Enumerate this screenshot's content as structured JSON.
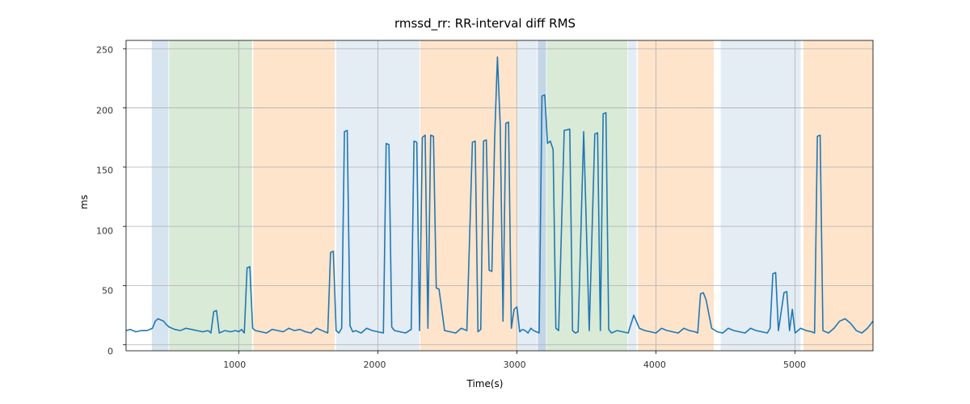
{
  "chart_data": {
    "type": "line",
    "title": "rmssd_rr: RR-interval diff RMS",
    "xlabel": "Time(s)",
    "ylabel": "ms",
    "xlim": [
      190,
      5560
    ],
    "ylim": [
      -5,
      257
    ],
    "x_ticks": [
      1000,
      2000,
      3000,
      4000,
      5000
    ],
    "y_ticks": [
      0,
      50,
      100,
      150,
      200,
      250
    ],
    "background_bands": [
      {
        "start": 375,
        "end": 495,
        "color": "#d6e4ef"
      },
      {
        "start": 500,
        "end": 1095,
        "color": "#d9ead7"
      },
      {
        "start": 1105,
        "end": 1690,
        "color": "#fde4cb"
      },
      {
        "start": 1700,
        "end": 2300,
        "color": "#e4ecf4"
      },
      {
        "start": 2305,
        "end": 3000,
        "color": "#fde4cb"
      },
      {
        "start": 3005,
        "end": 3145,
        "color": "#e4ecf4"
      },
      {
        "start": 3150,
        "end": 3210,
        "color": "#c3d6e6"
      },
      {
        "start": 3215,
        "end": 3795,
        "color": "#d9ead7"
      },
      {
        "start": 3800,
        "end": 3860,
        "color": "#e4ecf4"
      },
      {
        "start": 3870,
        "end": 4415,
        "color": "#fde4cb"
      },
      {
        "start": 4465,
        "end": 5040,
        "color": "#e4ecf4"
      },
      {
        "start": 5060,
        "end": 5560,
        "color": "#fde4cb"
      }
    ],
    "series": [
      {
        "name": "rmssd_rr",
        "color": "#1f77b4",
        "x": [
          190,
          220,
          260,
          300,
          340,
          380,
          400,
          420,
          440,
          460,
          480,
          500,
          540,
          580,
          620,
          660,
          700,
          740,
          780,
          800,
          820,
          840,
          860,
          900,
          940,
          980,
          1000,
          1020,
          1040,
          1060,
          1080,
          1100,
          1120,
          1160,
          1200,
          1240,
          1280,
          1320,
          1360,
          1400,
          1440,
          1480,
          1520,
          1560,
          1600,
          1640,
          1660,
          1680,
          1700,
          1720,
          1740,
          1760,
          1780,
          1800,
          1820,
          1840,
          1880,
          1920,
          1960,
          2000,
          2040,
          2060,
          2080,
          2100,
          2120,
          2160,
          2200,
          2240,
          2260,
          2280,
          2300,
          2320,
          2340,
          2360,
          2380,
          2400,
          2420,
          2440,
          2480,
          2520,
          2560,
          2600,
          2640,
          2680,
          2700,
          2720,
          2740,
          2760,
          2780,
          2800,
          2820,
          2840,
          2860,
          2880,
          2900,
          2920,
          2940,
          2960,
          2980,
          3000,
          3020,
          3040,
          3060,
          3080,
          3100,
          3120,
          3140,
          3160,
          3180,
          3200,
          3220,
          3240,
          3260,
          3280,
          3300,
          3340,
          3380,
          3400,
          3420,
          3440,
          3480,
          3520,
          3560,
          3580,
          3600,
          3620,
          3640,
          3660,
          3680,
          3720,
          3760,
          3800,
          3840,
          3880,
          3920,
          3960,
          4000,
          4040,
          4080,
          4120,
          4160,
          4200,
          4240,
          4280,
          4300,
          4320,
          4340,
          4360,
          4400,
          4440,
          4480,
          4520,
          4560,
          4600,
          4640,
          4680,
          4720,
          4760,
          4800,
          4820,
          4840,
          4860,
          4880,
          4920,
          4940,
          4960,
          4980,
          5000,
          5040,
          5080,
          5120,
          5140,
          5160,
          5180,
          5200,
          5240,
          5280,
          5320,
          5360,
          5400,
          5440,
          5480,
          5520,
          5560
        ],
        "y": [
          12,
          13,
          11,
          12,
          12,
          14,
          20,
          22,
          21,
          20,
          17,
          15,
          13,
          12,
          14,
          13,
          12,
          11,
          12,
          10,
          28,
          29,
          10,
          12,
          11,
          12,
          11,
          13,
          10,
          65,
          66,
          14,
          12,
          11,
          10,
          13,
          12,
          11,
          14,
          12,
          13,
          11,
          10,
          14,
          12,
          10,
          78,
          79,
          12,
          10,
          14,
          180,
          181,
          16,
          11,
          12,
          10,
          14,
          12,
          11,
          10,
          170,
          169,
          15,
          12,
          11,
          10,
          13,
          172,
          171,
          12,
          175,
          177,
          14,
          177,
          176,
          48,
          47,
          12,
          11,
          10,
          14,
          12,
          171,
          172,
          11,
          13,
          172,
          173,
          63,
          62,
          175,
          243,
          185,
          20,
          187,
          188,
          14,
          30,
          32,
          11,
          13,
          12,
          10,
          14,
          12,
          11,
          10,
          210,
          211,
          170,
          172,
          165,
          14,
          12,
          181,
          182,
          12,
          10,
          11,
          180,
          12,
          178,
          179,
          12,
          195,
          196,
          13,
          10,
          12,
          11,
          10,
          25,
          14,
          12,
          11,
          10,
          14,
          12,
          11,
          10,
          14,
          12,
          11,
          10,
          43,
          44,
          38,
          14,
          11,
          10,
          14,
          12,
          11,
          10,
          14,
          12,
          11,
          10,
          14,
          60,
          61,
          12,
          44,
          45,
          12,
          30,
          10,
          14,
          12,
          11,
          10,
          176,
          177,
          12,
          10,
          14,
          20,
          22,
          18,
          12,
          10,
          14,
          20
        ]
      }
    ]
  }
}
